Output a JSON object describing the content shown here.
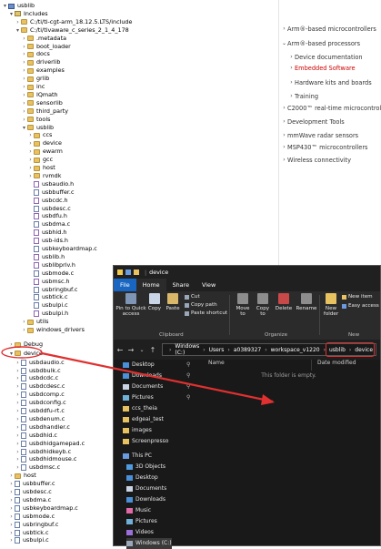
{
  "tree": [
    {
      "label": "usblib",
      "indent": 0,
      "toggle": "▾",
      "icon": "proj",
      "t": 0
    },
    {
      "label": "Includes",
      "indent": 1,
      "toggle": "▾",
      "icon": "lib",
      "t": 1
    },
    {
      "label": "C:/ti/ti-cgt-arm_18.12.5.LTS/include",
      "indent": 2,
      "toggle": "›",
      "icon": "folder",
      "t": 2
    },
    {
      "label": "C:/ti/tivaware_c_series_2_1_4_178",
      "indent": 2,
      "toggle": "▾",
      "icon": "folder",
      "t": 3
    },
    {
      "label": ".metadata",
      "indent": 3,
      "toggle": "›",
      "icon": "folder",
      "t": 4
    },
    {
      "label": "boot_loader",
      "indent": 3,
      "toggle": "›",
      "icon": "folder",
      "t": 5
    },
    {
      "label": "docs",
      "indent": 3,
      "toggle": "›",
      "icon": "folder",
      "t": 6
    },
    {
      "label": "driverlib",
      "indent": 3,
      "toggle": "›",
      "icon": "folder",
      "t": 7
    },
    {
      "label": "examples",
      "indent": 3,
      "toggle": "›",
      "icon": "folder",
      "t": 8
    },
    {
      "label": "grlib",
      "indent": 3,
      "toggle": "›",
      "icon": "folder",
      "t": 9
    },
    {
      "label": "inc",
      "indent": 3,
      "toggle": "›",
      "icon": "folder",
      "t": 10
    },
    {
      "label": "IQmath",
      "indent": 3,
      "toggle": "›",
      "icon": "folder",
      "t": 11
    },
    {
      "label": "sensorlib",
      "indent": 3,
      "toggle": "›",
      "icon": "folder",
      "t": 12
    },
    {
      "label": "third_party",
      "indent": 3,
      "toggle": "›",
      "icon": "folder",
      "t": 13
    },
    {
      "label": "tools",
      "indent": 3,
      "toggle": "›",
      "icon": "folder",
      "t": 14
    },
    {
      "label": "usblib",
      "indent": 3,
      "toggle": "▾",
      "icon": "folder",
      "t": 15
    },
    {
      "label": "ccs",
      "indent": 4,
      "toggle": "›",
      "icon": "folder",
      "t": 16
    },
    {
      "label": "device",
      "indent": 4,
      "toggle": "›",
      "icon": "folder",
      "t": 17
    },
    {
      "label": "ewarm",
      "indent": 4,
      "toggle": "›",
      "icon": "folder",
      "t": 18
    },
    {
      "label": "gcc",
      "indent": 4,
      "toggle": "›",
      "icon": "folder",
      "t": 19
    },
    {
      "label": "host",
      "indent": 4,
      "toggle": "›",
      "icon": "folder",
      "t": 20
    },
    {
      "label": "rvmdk",
      "indent": 4,
      "toggle": "›",
      "icon": "folder",
      "t": 21
    },
    {
      "label": "usbaudio.h",
      "indent": 4,
      "toggle": "",
      "icon": "hfile",
      "t": 22
    },
    {
      "label": "usbbuffer.c",
      "indent": 4,
      "toggle": "",
      "icon": "file",
      "t": 23
    },
    {
      "label": "usbcdc.h",
      "indent": 4,
      "toggle": "",
      "icon": "hfile",
      "t": 24
    },
    {
      "label": "usbdesc.c",
      "indent": 4,
      "toggle": "",
      "icon": "file",
      "t": 25
    },
    {
      "label": "usbdfu.h",
      "indent": 4,
      "toggle": "",
      "icon": "hfile",
      "t": 26
    },
    {
      "label": "usbdma.c",
      "indent": 4,
      "toggle": "",
      "icon": "file",
      "t": 27
    },
    {
      "label": "usbhid.h",
      "indent": 4,
      "toggle": "",
      "icon": "hfile",
      "t": 28
    },
    {
      "label": "usb-ids.h",
      "indent": 4,
      "toggle": "",
      "icon": "hfile",
      "t": 29
    },
    {
      "label": "usbkeyboardmap.c",
      "indent": 4,
      "toggle": "",
      "icon": "file",
      "t": 30
    },
    {
      "label": "usblib.h",
      "indent": 4,
      "toggle": "",
      "icon": "hfile",
      "t": 31
    },
    {
      "label": "usblibpriv.h",
      "indent": 4,
      "toggle": "",
      "icon": "hfile",
      "t": 32
    },
    {
      "label": "usbmode.c",
      "indent": 4,
      "toggle": "",
      "icon": "file",
      "t": 33
    },
    {
      "label": "usbmsc.h",
      "indent": 4,
      "toggle": "",
      "icon": "hfile",
      "t": 34
    },
    {
      "label": "usbringbuf.c",
      "indent": 4,
      "toggle": "",
      "icon": "file",
      "t": 35
    },
    {
      "label": "usbtick.c",
      "indent": 4,
      "toggle": "",
      "icon": "file",
      "t": 36
    },
    {
      "label": "usbulpi.c",
      "indent": 4,
      "toggle": "",
      "icon": "file",
      "t": 37
    },
    {
      "label": "usbulpi.h",
      "indent": 4,
      "toggle": "",
      "icon": "hfile",
      "t": 38
    },
    {
      "label": "utils",
      "indent": 3,
      "toggle": "›",
      "icon": "folder",
      "t": 39
    },
    {
      "label": "windows_drivers",
      "indent": 3,
      "toggle": "›",
      "icon": "folder",
      "t": 40
    },
    {
      "label": "Debug",
      "indent": 1,
      "toggle": "›",
      "icon": "folder",
      "t": 41.8
    },
    {
      "label": "device",
      "indent": 1,
      "toggle": "▾",
      "icon": "folder",
      "t": 42.9
    },
    {
      "label": "usbdaudio.c",
      "indent": 2,
      "toggle": "›",
      "icon": "file",
      "t": 44
    },
    {
      "label": "usbdbulk.c",
      "indent": 2,
      "toggle": "›",
      "icon": "file",
      "t": 45
    },
    {
      "label": "usbdcdc.c",
      "indent": 2,
      "toggle": "›",
      "icon": "file",
      "t": 46
    },
    {
      "label": "usbdcdesc.c",
      "indent": 2,
      "toggle": "›",
      "icon": "file",
      "t": 47
    },
    {
      "label": "usbdcomp.c",
      "indent": 2,
      "toggle": "›",
      "icon": "file",
      "t": 48
    },
    {
      "label": "usbdconfig.c",
      "indent": 2,
      "toggle": "›",
      "icon": "file",
      "t": 49
    },
    {
      "label": "usbddfu-rt.c",
      "indent": 2,
      "toggle": "›",
      "icon": "file",
      "t": 50
    },
    {
      "label": "usbdenum.c",
      "indent": 2,
      "toggle": "›",
      "icon": "file",
      "t": 51
    },
    {
      "label": "usbdhandler.c",
      "indent": 2,
      "toggle": "›",
      "icon": "file",
      "t": 52
    },
    {
      "label": "usbdhid.c",
      "indent": 2,
      "toggle": "›",
      "icon": "file",
      "t": 53
    },
    {
      "label": "usbdhidgamepad.c",
      "indent": 2,
      "toggle": "›",
      "icon": "file",
      "t": 54
    },
    {
      "label": "usbdhidkeyb.c",
      "indent": 2,
      "toggle": "›",
      "icon": "file",
      "t": 55
    },
    {
      "label": "usbdhidmouse.c",
      "indent": 2,
      "toggle": "›",
      "icon": "file",
      "t": 56
    },
    {
      "label": "usbdmsc.c",
      "indent": 2,
      "toggle": "›",
      "icon": "file",
      "t": 57
    },
    {
      "label": "host",
      "indent": 1,
      "toggle": "›",
      "icon": "folder",
      "t": 58
    },
    {
      "label": "usbbuffer.c",
      "indent": 1,
      "toggle": "›",
      "icon": "file",
      "t": 59
    },
    {
      "label": "usbdesc.c",
      "indent": 1,
      "toggle": "›",
      "icon": "file",
      "t": 60
    },
    {
      "label": "usbdma.c",
      "indent": 1,
      "toggle": "›",
      "icon": "file",
      "t": 61
    },
    {
      "label": "usbkeyboardmap.c",
      "indent": 1,
      "toggle": "›",
      "icon": "file",
      "t": 62
    },
    {
      "label": "usbmode.c",
      "indent": 1,
      "toggle": "›",
      "icon": "file",
      "t": 63
    },
    {
      "label": "usbringbuf.c",
      "indent": 1,
      "toggle": "›",
      "icon": "file",
      "t": 64
    },
    {
      "label": "usbtick.c",
      "indent": 1,
      "toggle": "›",
      "icon": "file",
      "t": 65
    },
    {
      "label": "usbulpi.c",
      "indent": 1,
      "toggle": "›",
      "icon": "file",
      "t": 66
    }
  ],
  "right_panel": [
    {
      "label": "Arm®-based microcontrollers",
      "toggle": "›",
      "red": false,
      "indent": 0
    },
    {
      "label": "Arm®-based processors",
      "toggle": "⌄",
      "red": false,
      "indent": 0
    },
    {
      "label": "Device documentation",
      "toggle": "›",
      "red": false,
      "indent": 1
    },
    {
      "label": "Embedded Software",
      "toggle": "›",
      "red": true,
      "indent": 1
    },
    {
      "label": "Hardware kits and boards",
      "toggle": "›",
      "red": false,
      "indent": 1
    },
    {
      "label": "Training",
      "toggle": "›",
      "red": false,
      "indent": 1
    },
    {
      "label": "C2000™ real-time microcontrollers",
      "toggle": "›",
      "red": false,
      "indent": 0
    },
    {
      "label": "Development Tools",
      "toggle": "›",
      "red": false,
      "indent": 0
    },
    {
      "label": "mmWave radar sensors",
      "toggle": "›",
      "red": false,
      "indent": 0
    },
    {
      "label": "MSP430™ microcontrollers",
      "toggle": "›",
      "red": false,
      "indent": 0
    },
    {
      "label": "Wireless connectivity",
      "toggle": "›",
      "red": false,
      "indent": 0
    }
  ],
  "explorer": {
    "window_title": "device",
    "tabs": [
      "File",
      "Home",
      "Share",
      "View"
    ],
    "ribbon": {
      "pin": "Pin to Quick access",
      "copy": "Copy",
      "paste": "Paste",
      "cut": "Cut",
      "copy_path": "Copy path",
      "paste_shortcut": "Paste shortcut",
      "clipboard_group": "Clipboard",
      "move_to": "Move to",
      "copy_to": "Copy to",
      "delete": "Delete",
      "rename": "Rename",
      "organize_group": "Organize",
      "new_folder": "New folder",
      "new_item": "New item",
      "easy_access": "Easy access",
      "new_group": "New"
    },
    "address": [
      "Windows (C:)",
      "Users",
      "a0389327",
      "workspace_v1220",
      "usblib",
      "device"
    ],
    "nav": [
      {
        "label": "Desktop",
        "pin": true
      },
      {
        "label": "Downloads",
        "pin": true
      },
      {
        "label": "Documents",
        "pin": true
      },
      {
        "label": "Pictures",
        "pin": true
      },
      {
        "label": "ccs_theia",
        "pin": false
      },
      {
        "label": "edgeai_test",
        "pin": false
      },
      {
        "label": "images",
        "pin": false
      },
      {
        "label": "Screenpresso",
        "pin": false
      },
      {
        "label": "This PC",
        "pin": false
      },
      {
        "label": "3D Objects",
        "pin": false
      },
      {
        "label": "Desktop",
        "pin": false
      },
      {
        "label": "Documents",
        "pin": false
      },
      {
        "label": "Downloads",
        "pin": false
      },
      {
        "label": "Music",
        "pin": false
      },
      {
        "label": "Pictures",
        "pin": false
      },
      {
        "label": "Videos",
        "pin": false
      },
      {
        "label": "Windows (C:)",
        "pin": false
      }
    ],
    "columns": {
      "name": "Name",
      "date": "Date modified"
    },
    "empty_text": "This folder is empty."
  },
  "colors": {
    "accent_red": "#e03030",
    "file_tab": "#1966c2",
    "dark_bg": "#191919"
  }
}
